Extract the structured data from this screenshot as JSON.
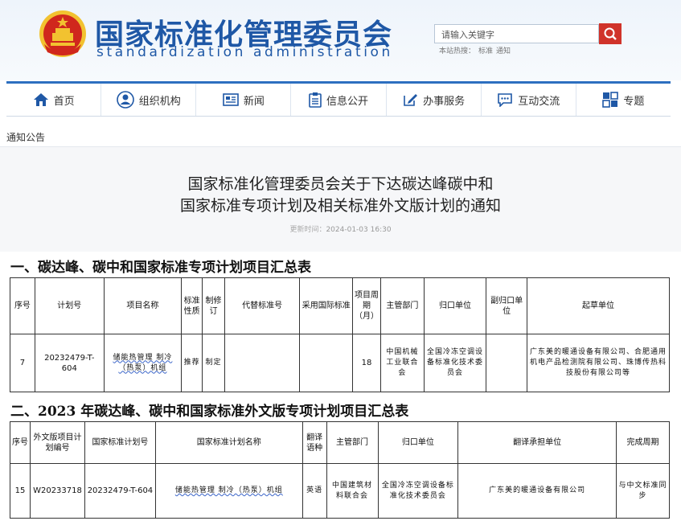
{
  "header": {
    "brand_cn": "国家标准化管理委员会",
    "brand_en": "standardization administration",
    "search_placeholder": "请输入关键字",
    "hot_label": "本站热搜：",
    "hot_terms": [
      "标准",
      "通知"
    ],
    "accent_color": "#1f58a6",
    "search_button_color": "#d0332a"
  },
  "nav": {
    "items": [
      {
        "label": "首页",
        "icon": "home-icon"
      },
      {
        "label": "组织机构",
        "icon": "user-circle-icon"
      },
      {
        "label": "新闻",
        "icon": "newspaper-icon"
      },
      {
        "label": "信息公开",
        "icon": "clipboard-icon"
      },
      {
        "label": "办事服务",
        "icon": "edit-icon"
      },
      {
        "label": "互动交流",
        "icon": "chat-icon"
      },
      {
        "label": "专题",
        "icon": "grid-icon"
      }
    ]
  },
  "breadcrumb": "通知公告",
  "article": {
    "title_line1": "国家标准化管理委员会关于下达碳达峰碳中和",
    "title_line2": "国家标准专项计划及相关标准外文版计划的通知",
    "time_label": "更新时间：",
    "time_value": "2024-01-03 16:30"
  },
  "section1": {
    "heading": "一、碳达峰、碳中和国家标准专项计划项目汇总表",
    "headers": [
      "序号",
      "计划号",
      "项目名称",
      "标准性质",
      "制修订",
      "代替标准号",
      "采用国际标准",
      "项目周期（月）",
      "主管部门",
      "归口单位",
      "副归口单位",
      "起草单位"
    ],
    "row": {
      "seq": "7",
      "plan_no": "20232479-T-604",
      "name": "储能热管理 制冷（热泵）机组",
      "nature": "推荐",
      "revise": "制定",
      "replace": "",
      "intl": "",
      "period": "18",
      "dept": "中国机械工业联合会",
      "unit": "全国冷冻空调设备标准化技术委员会",
      "sub_unit": "",
      "drafters": "广东美的暖通设备有限公司、合肥通用机电产品检测院有限公司、珠博传热科技股份有限公司等"
    }
  },
  "section2": {
    "heading": "二、2023 年碳达峰、碳中和国家标准外文版专项计划项目汇总表",
    "headers": [
      "序号",
      "外文版项目计划编号",
      "国家标准计划号",
      "国家标准计划名称",
      "翻译语种",
      "主管部门",
      "归口单位",
      "翻译承担单位",
      "完成周期"
    ],
    "row": {
      "seq": "15",
      "foreign_no": "W20233718",
      "plan_no": "20232479-T-604",
      "name": "储能热管理 制冷（热泵）机组",
      "lang": "英语",
      "dept": "中国建筑材料联合会",
      "unit": "全国冷冻空调设备标准化技术委员会",
      "translator": "广东美的暖通设备有限公司",
      "period": "与中文标准同步"
    }
  }
}
